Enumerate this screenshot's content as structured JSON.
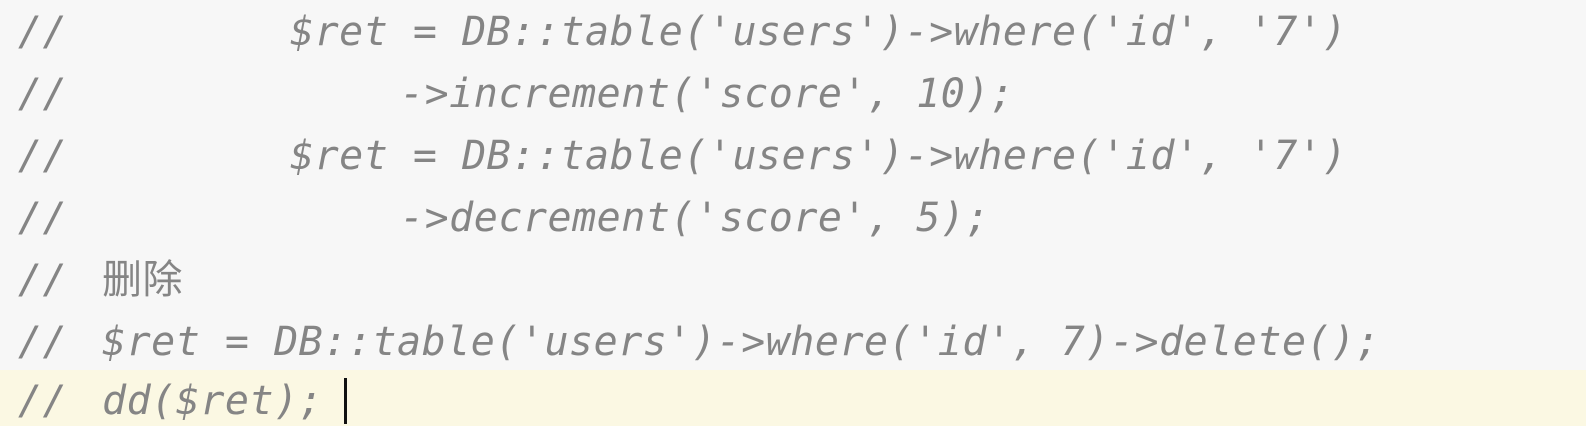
{
  "editor": {
    "lines": [
      {
        "comment": "//",
        "code": "$ret = DB::table('users')->where('id', '7')"
      },
      {
        "comment": "//",
        "code": "->increment('score', 10);"
      },
      {
        "comment": "//",
        "code": "$ret = DB::table('users')->where('id', '7')"
      },
      {
        "comment": "//",
        "code": "->decrement('score', 5);"
      },
      {
        "comment": "//",
        "code": "删除"
      },
      {
        "comment": "//",
        "code": "$ret = DB::table('users')->where('id', 7)->delete();"
      },
      {
        "comment": "//",
        "code": "dd($ret);"
      }
    ]
  },
  "colors": {
    "background": "#f7f7f7",
    "current_line": "#fbf8e3",
    "comment_text": "#858585",
    "caret": "#111111"
  }
}
